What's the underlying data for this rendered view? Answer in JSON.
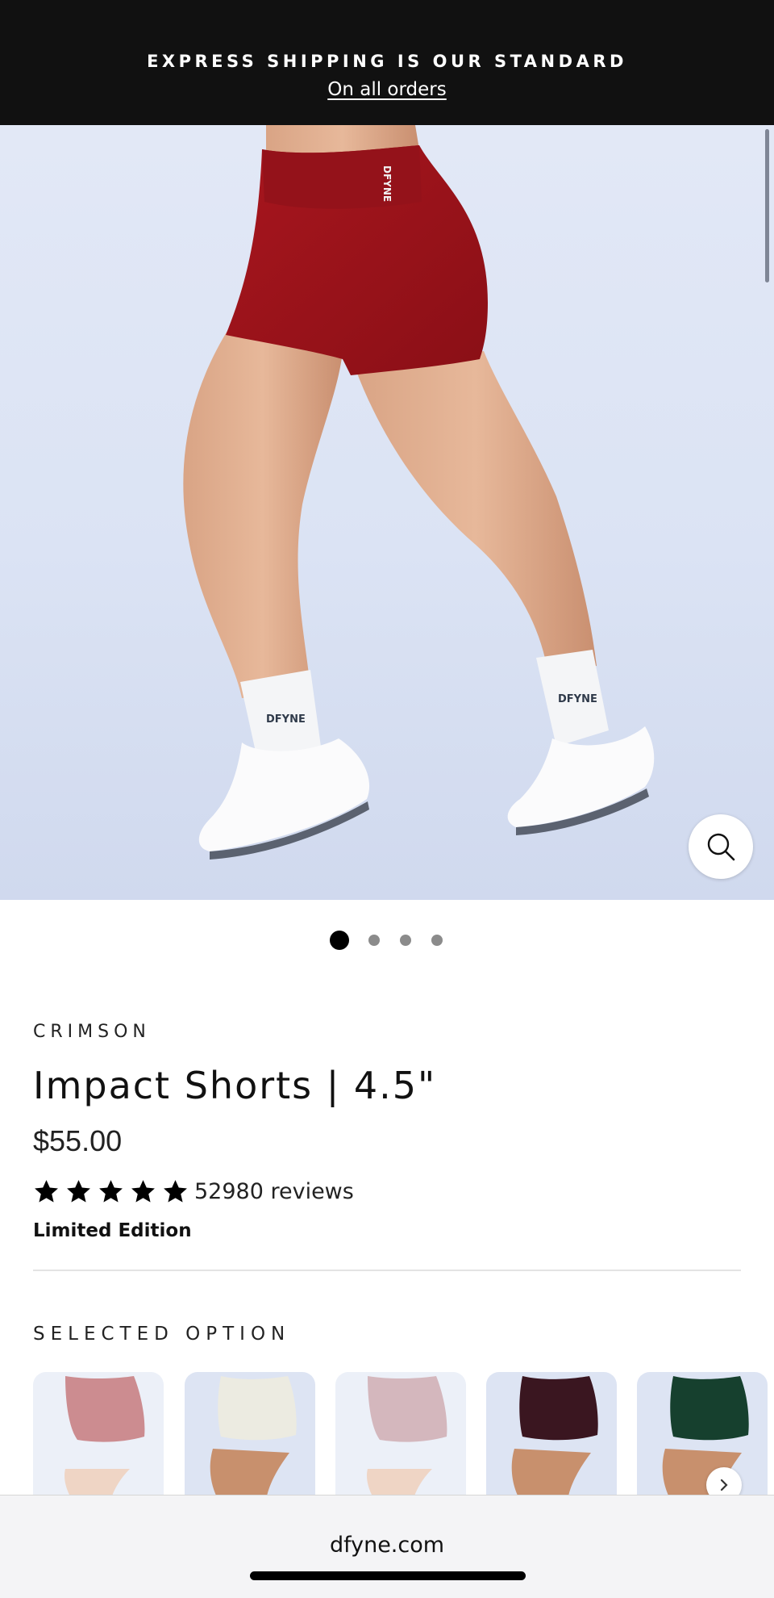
{
  "announcement": {
    "headline": "EXPRESS SHIPPING IS OUR STANDARD",
    "link": "On all orders"
  },
  "hero": {
    "waistband_logo": "DFYNE",
    "sock_logo_left": "DFYNE",
    "sock_logo_right": "DFYNE",
    "zoom_icon": "magnifier-icon",
    "slide_count": 4,
    "active_slide": 1
  },
  "product": {
    "color": "CRIMSON",
    "title": "Impact Shorts | 4.5\"",
    "price": "$55.00",
    "rating_stars": 5,
    "reviews": "52980 reviews",
    "edition": "Limited Edition"
  },
  "options": {
    "label": "SELECTED OPTION",
    "swatch_colors": [
      "#a32f36",
      "#ecebe1",
      "#b27d88",
      "#3a1620",
      "#16402e"
    ]
  },
  "browser": {
    "url": "dfyne.com"
  },
  "colors": {
    "banner_bg": "#111111",
    "shorts": "#9b131a",
    "hero_bg": "#dbe3f4"
  }
}
